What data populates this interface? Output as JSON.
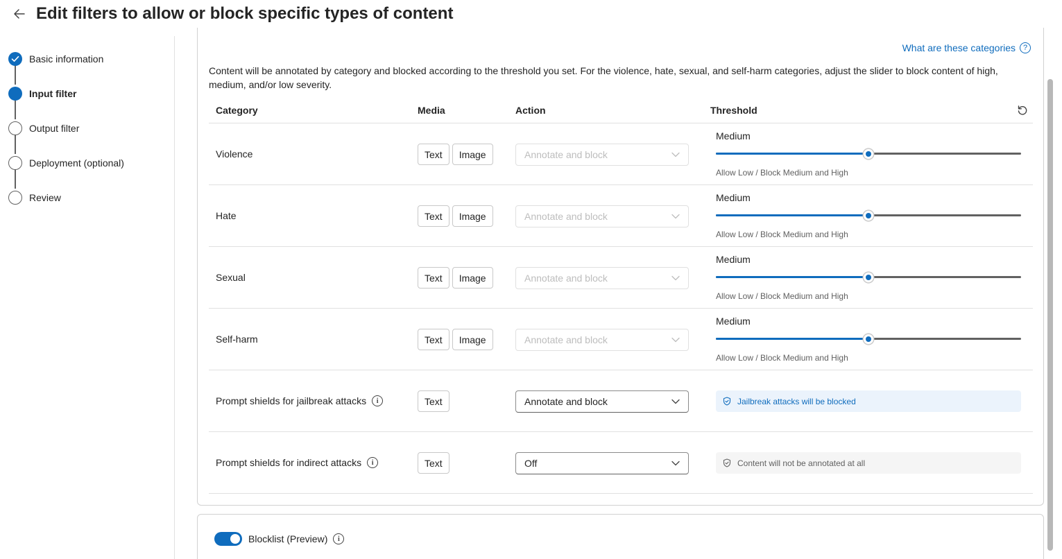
{
  "header": {
    "title": "Edit filters to allow or block specific types of content"
  },
  "steps": [
    {
      "label": "Basic information",
      "state": "done"
    },
    {
      "label": "Input filter",
      "state": "current"
    },
    {
      "label": "Output filter",
      "state": "todo"
    },
    {
      "label": "Deployment (optional)",
      "state": "todo"
    },
    {
      "label": "Review",
      "state": "todo"
    }
  ],
  "content": {
    "help_link": "What are these categories",
    "description": "Content will be annotated by category and blocked according to the threshold you set. For the violence, hate, sexual, and self-harm categories, adjust the slider to block content of high, medium, and/or low severity."
  },
  "table": {
    "headers": {
      "category": "Category",
      "media": "Media",
      "action": "Action",
      "threshold": "Threshold"
    },
    "rows": [
      {
        "category": "Violence",
        "media": [
          "Text",
          "Image"
        ],
        "action": "Annotate and block",
        "threshold_level": "Medium",
        "threshold_hint": "Allow Low / Block Medium and High",
        "slider_fraction": 0.5
      },
      {
        "category": "Hate",
        "media": [
          "Text",
          "Image"
        ],
        "action": "Annotate and block",
        "threshold_level": "Medium",
        "threshold_hint": "Allow Low / Block Medium and High",
        "slider_fraction": 0.5
      },
      {
        "category": "Sexual",
        "media": [
          "Text",
          "Image"
        ],
        "action": "Annotate and block",
        "threshold_level": "Medium",
        "threshold_hint": "Allow Low / Block Medium and High",
        "slider_fraction": 0.5
      },
      {
        "category": "Self-harm",
        "media": [
          "Text",
          "Image"
        ],
        "action": "Annotate and block",
        "threshold_level": "Medium",
        "threshold_hint": "Allow Low / Block Medium and High",
        "slider_fraction": 0.5
      }
    ],
    "shield_rows": [
      {
        "category": "Prompt shields for jailbreak attacks",
        "media": "Text",
        "action": "Annotate and block",
        "status": "Jailbreak attacks will be blocked"
      },
      {
        "category": "Prompt shields for indirect attacks",
        "media": "Text",
        "action": "Off",
        "status": "Content will not be annotated at all"
      }
    ]
  },
  "blocklist": {
    "label": "Blocklist (Preview)",
    "enabled": true
  },
  "colors": {
    "accent": "#0f6cbd",
    "info_banner_bg": "#ebf3fc",
    "neutral_banner_bg": "#f5f5f5"
  }
}
